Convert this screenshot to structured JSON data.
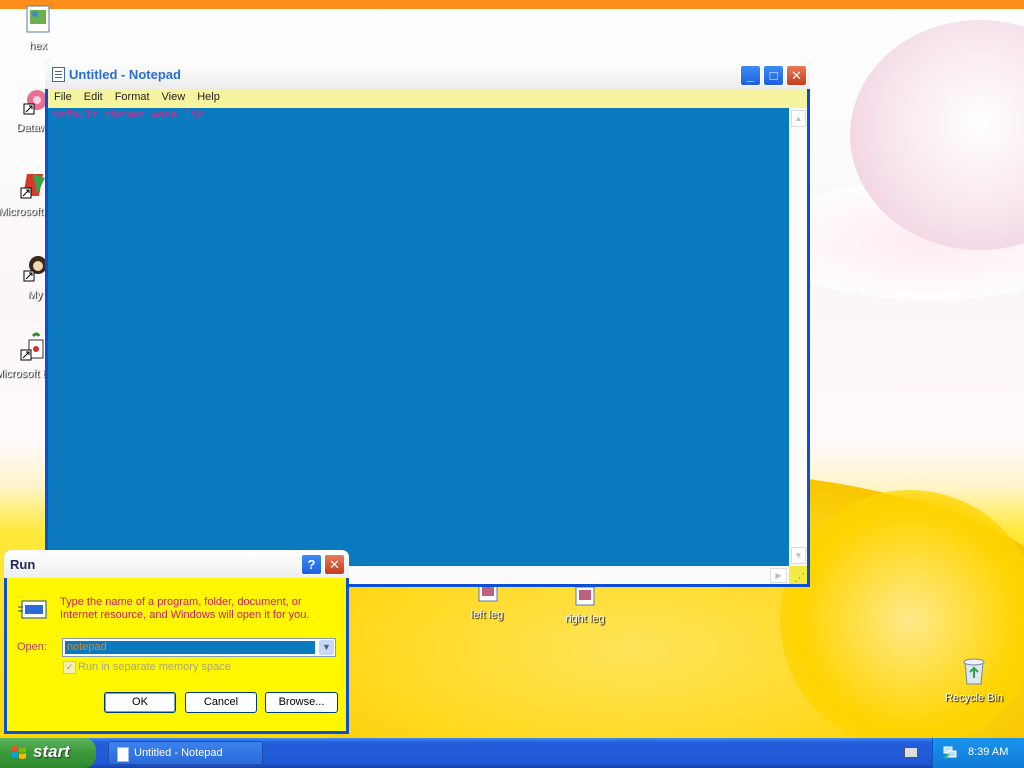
{
  "desktop": {
    "icons": [
      {
        "label": "hex"
      },
      {
        "label": "Datawa"
      },
      {
        "label": "Microsoft Citri"
      },
      {
        "label": "My"
      },
      {
        "label": "Microsoft Basic"
      },
      {
        "label": "left leg"
      },
      {
        "label": "right leg"
      },
      {
        "label": "Recycle Bin"
      }
    ]
  },
  "notepad": {
    "title": "Untitled - Notepad",
    "menu": [
      "File",
      "Edit",
      "Format",
      "View",
      "Help"
    ],
    "content": "default themes were lik",
    "colors": {
      "background": "#0a79bd",
      "text": "#e0258c",
      "menubar": "#f7f4a0"
    }
  },
  "run_dialog": {
    "title": "Run",
    "description": "Type the name of a program, folder, document, or Internet resource, and Windows will open it for you.",
    "open_label": "Open:",
    "open_value": "notepad",
    "checkbox_label": "Run in separate memory space",
    "buttons": {
      "ok": "OK",
      "cancel": "Cancel",
      "browse": "Browse..."
    },
    "colors": {
      "body": "#fff700",
      "text": "#d01c6a"
    }
  },
  "taskbar": {
    "start_label": "start",
    "tasks": [
      {
        "label": "Untitled - Notepad"
      }
    ],
    "clock": "8:39 AM"
  }
}
